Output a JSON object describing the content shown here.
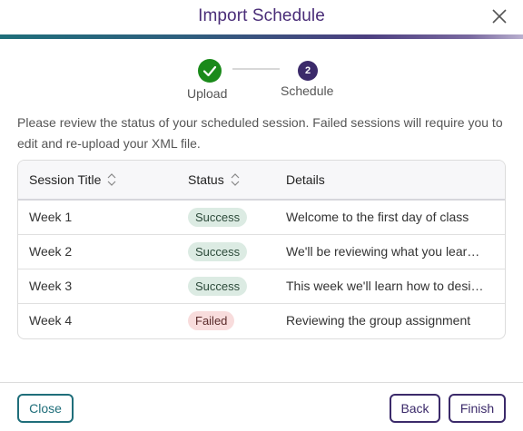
{
  "dialog": {
    "title": "Import Schedule"
  },
  "stepper": {
    "steps": [
      {
        "label": "Upload",
        "state": "complete",
        "icon": "checkmark-icon"
      },
      {
        "label": "Schedule",
        "state": "current",
        "number": "2"
      }
    ]
  },
  "instructions": "Please review the status of your scheduled session. Failed sessions will require you to edit and re-upload your XML file.",
  "table": {
    "columns": [
      "Session Title",
      "Status",
      "Details"
    ],
    "rows": [
      {
        "title": "Week 1",
        "status": "Success",
        "details": "Welcome to the first day of class"
      },
      {
        "title": "Week 2",
        "status": "Success",
        "details": "We'll be reviewing what you learned"
      },
      {
        "title": "Week 3",
        "status": "Success",
        "details": "This week we'll learn how to design"
      },
      {
        "title": "Week 4",
        "status": "Failed",
        "details": "Reviewing the group assignment"
      }
    ]
  },
  "footer": {
    "close_label": "Close",
    "back_label": "Back",
    "finish_label": "Finish"
  },
  "colors": {
    "brand_purple": "#3b2a6a",
    "teal": "#1f6e7a",
    "success_green": "#1a8a1a",
    "success_badge_bg": "#dcebe3",
    "failed_badge_bg": "#f8dcdc"
  }
}
